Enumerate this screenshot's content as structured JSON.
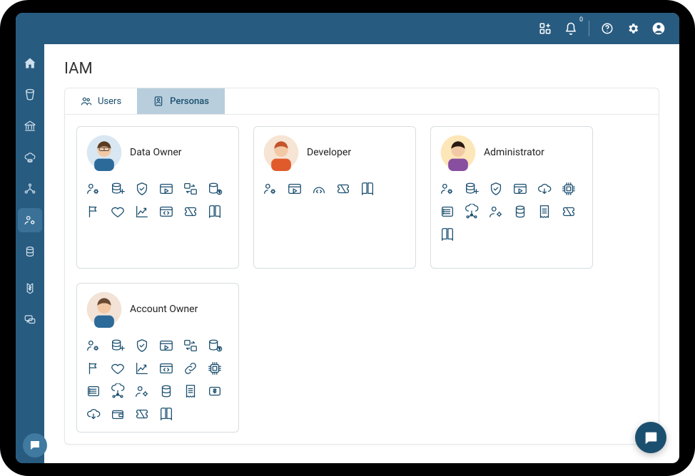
{
  "brand_color": "#285b80",
  "topbar": {
    "notifications_count": "0"
  },
  "sidebar": {
    "items": [
      {
        "name": "home"
      },
      {
        "name": "bucket"
      },
      {
        "name": "bank"
      },
      {
        "name": "cloud-db"
      },
      {
        "name": "network"
      },
      {
        "name": "iam",
        "active": true
      },
      {
        "name": "db"
      },
      {
        "name": "billing"
      },
      {
        "name": "chat"
      }
    ]
  },
  "page": {
    "title": "IAM"
  },
  "tabs": {
    "users": {
      "label": "Users",
      "active": false
    },
    "personas": {
      "label": "Personas",
      "active": true
    }
  },
  "personas": [
    {
      "name": "Data Owner",
      "avatar_bg": "#d9e7f2",
      "abilities": [
        "user-gear",
        "db-plus",
        "shield",
        "play-window",
        "transfer",
        "db-money",
        "flag",
        "heart",
        "chart-up",
        "code-window",
        "ticket",
        "book"
      ]
    },
    {
      "name": "Developer",
      "avatar_bg": "#f6e4d4",
      "abilities": [
        "user-gear",
        "play-window",
        "code-arch",
        "ticket",
        "book"
      ]
    },
    {
      "name": "Administrator",
      "avatar_bg": "#fde6b8",
      "abilities": [
        "user-gear",
        "db-plus",
        "shield",
        "play-window",
        "cloud-down",
        "chip",
        "list",
        "cloud-net",
        "user-cog",
        "db",
        "receipt",
        "ticket",
        "book"
      ]
    },
    {
      "name": "Account Owner",
      "avatar_bg": "#f2e3d6",
      "abilities": [
        "user-gear",
        "db-plus",
        "shield",
        "play-window",
        "transfer",
        "db-money",
        "flag",
        "heart",
        "chart-up",
        "code-window",
        "link",
        "chip",
        "list",
        "cloud-net",
        "user-cog",
        "db",
        "receipt",
        "money-box",
        "cloud-down",
        "wallet",
        "ticket",
        "book"
      ]
    }
  ]
}
